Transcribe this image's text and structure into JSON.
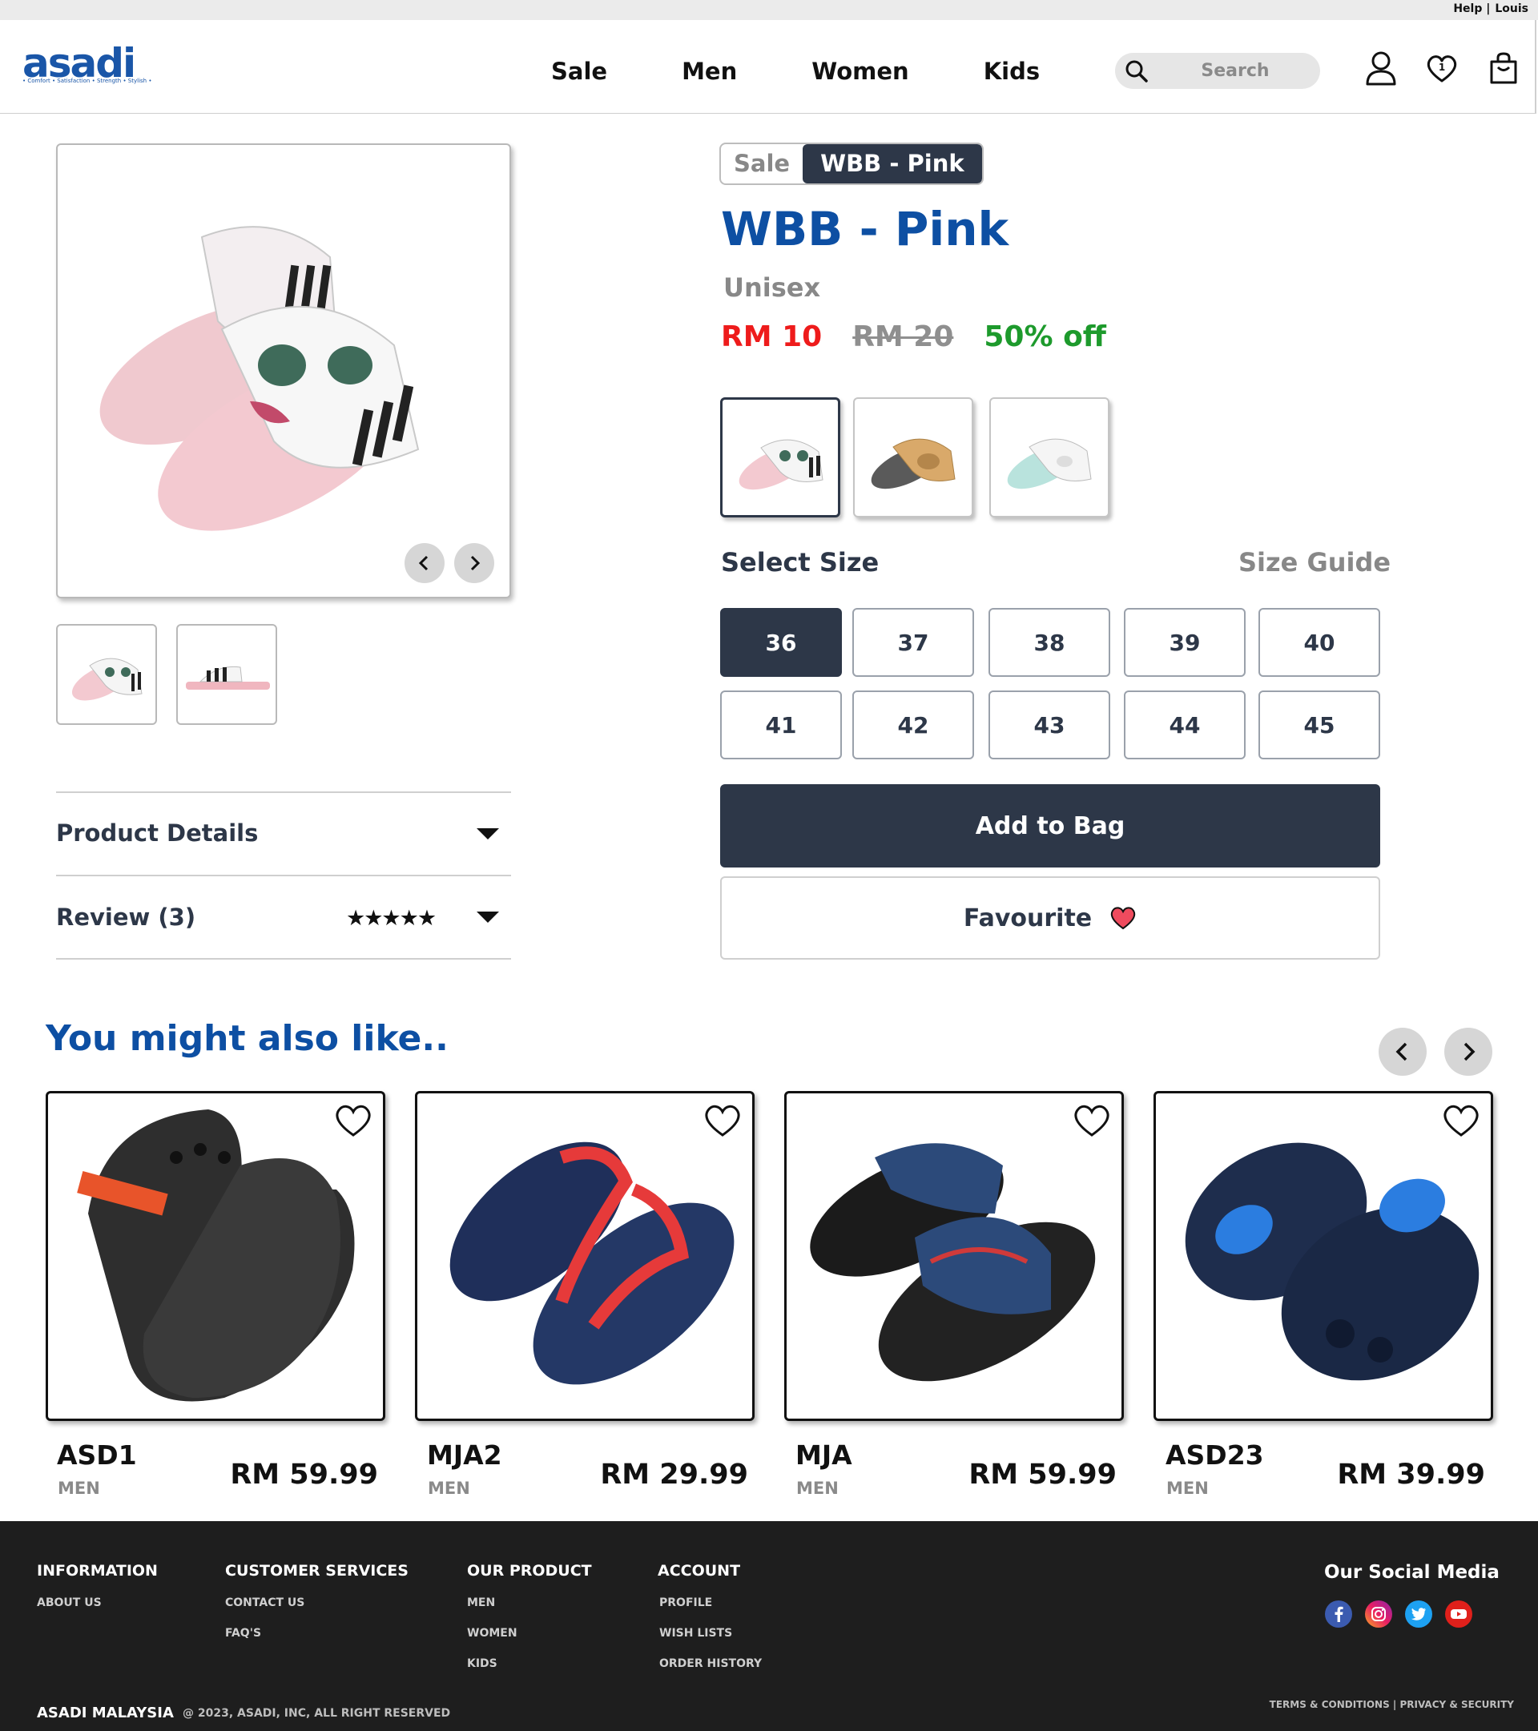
{
  "topbar": {
    "help": "Help |",
    "user": "Louis"
  },
  "header": {
    "logo": "asadi",
    "logo_tagline": "• Comfort • Satisfaction • Strength • Stylish •",
    "nav": [
      "Sale",
      "Men",
      "Women",
      "Kids"
    ],
    "search_placeholder": "Search",
    "favourites_count": "1"
  },
  "product": {
    "breadcrumb": [
      "Sale",
      "WBB - Pink"
    ],
    "title": "WBB - Pink",
    "gender": "Unisex",
    "price_now": "RM 10",
    "price_old": "RM 20",
    "discount": "50% off",
    "variants": [
      "pink",
      "grey",
      "mint"
    ],
    "selected_variant": "pink",
    "select_size_label": "Select Size",
    "size_guide_label": "Size Guide",
    "sizes": [
      "36",
      "37",
      "38",
      "39",
      "40",
      "41",
      "42",
      "43",
      "44",
      "45"
    ],
    "selected_size": "36",
    "add_to_bag": "Add to Bag",
    "favourite": "Favourite",
    "accordion": {
      "details": "Product Details",
      "review": "Review (3)",
      "rating": 5
    }
  },
  "recommendations": {
    "title": "You might also like..",
    "items": [
      {
        "name": "ASD1",
        "category": "MEN",
        "price": "RM 59.99"
      },
      {
        "name": "MJA2",
        "category": "MEN",
        "price": "RM 29.99"
      },
      {
        "name": "MJA",
        "category": "MEN",
        "price": "RM 59.99"
      },
      {
        "name": "ASD23",
        "category": "MEN",
        "price": "RM 39.99"
      }
    ]
  },
  "footer": {
    "columns": [
      {
        "title": "INFORMATION",
        "links": [
          "ABOUT US"
        ]
      },
      {
        "title": "CUSTOMER SERVICES",
        "links": [
          "CONTACT US",
          "FAQ'S"
        ]
      },
      {
        "title": "OUR PRODUCT",
        "links": [
          "MEN",
          "WOMEN",
          "KIDS"
        ]
      },
      {
        "title": "ACCOUNT",
        "links": [
          "PROFILE",
          "WISH LISTS",
          "ORDER HISTORY"
        ]
      }
    ],
    "social_title": "Our Social Media",
    "social": [
      "facebook-icon",
      "instagram-icon",
      "twitter-icon",
      "youtube-icon"
    ],
    "brand": "ASADI MALAYSIA",
    "copyright": "@ 2023, ASADI, INC, ALL RIGHT RESERVED",
    "terms": "TERMS & CONDITIONS | PRIVACY & SECURITY"
  },
  "colors": {
    "primary_dark": "#2d3748",
    "brand_blue": "#0d4fa3",
    "sale_red": "#ee1b1b",
    "discount_green": "#1d9a2c",
    "footer_bg": "#1e1e1e"
  }
}
